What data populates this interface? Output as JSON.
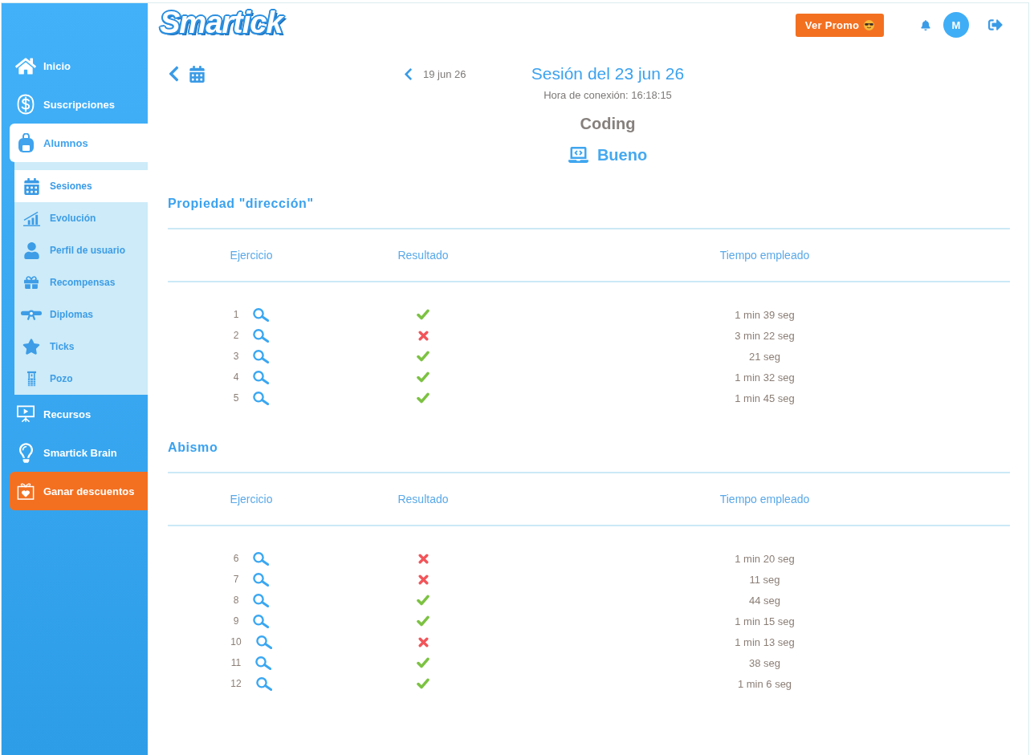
{
  "header": {
    "logo": "Smartick",
    "promo_button": "Ver Promo",
    "avatar_initial": "M"
  },
  "sidebar": {
    "items": [
      {
        "label": "Inicio",
        "kind": "nav",
        "selected": false
      },
      {
        "label": "Suscripciones",
        "kind": "nav",
        "selected": false
      },
      {
        "label": "Alumnos",
        "kind": "nav",
        "selected": true,
        "children": [
          {
            "label": "Sesiones",
            "selected": true
          },
          {
            "label": "Evolución",
            "selected": false
          },
          {
            "label": "Perfil de usuario",
            "selected": false
          },
          {
            "label": "Recompensas",
            "selected": false
          },
          {
            "label": "Diplomas",
            "selected": false
          },
          {
            "label": "Ticks",
            "selected": false
          },
          {
            "label": "Pozo",
            "selected": false
          }
        ]
      },
      {
        "label": "Recursos",
        "kind": "nav",
        "selected": false
      },
      {
        "label": "Smartick Brain",
        "kind": "nav",
        "selected": false
      },
      {
        "label": "Ganar descuentos",
        "kind": "promo",
        "selected": false
      }
    ]
  },
  "session": {
    "previous_session": "19 jun 26",
    "title": "Sesión del 23 jun 26",
    "connection_time": "Hora de conexión: 16:18:15",
    "subject": "Coding",
    "rating": "Bueno"
  },
  "sections": [
    {
      "title": "Propiedad \"dirección\"",
      "columns": [
        "Ejercicio",
        "Resultado",
        "Tiempo empleado"
      ],
      "rows": [
        {
          "number": "1",
          "correct": true,
          "time": "1 min 39 seg"
        },
        {
          "number": "2",
          "correct": false,
          "time": "3 min 22 seg"
        },
        {
          "number": "3",
          "correct": true,
          "time": "21 seg"
        },
        {
          "number": "4",
          "correct": true,
          "time": "1 min 32 seg"
        },
        {
          "number": "5",
          "correct": true,
          "time": "1 min 45 seg"
        }
      ]
    },
    {
      "title": "Abismo",
      "columns": [
        "Ejercicio",
        "Resultado",
        "Tiempo empleado"
      ],
      "rows": [
        {
          "number": "6",
          "correct": false,
          "time": "1 min 20 seg"
        },
        {
          "number": "7",
          "correct": false,
          "time": "11 seg"
        },
        {
          "number": "8",
          "correct": true,
          "time": "44 seg"
        },
        {
          "number": "9",
          "correct": true,
          "time": "1 min 15 seg"
        },
        {
          "number": "10",
          "correct": false,
          "time": "1 min 13 seg"
        },
        {
          "number": "11",
          "correct": true,
          "time": "38 seg"
        },
        {
          "number": "12",
          "correct": true,
          "time": "1 min 6 seg"
        }
      ]
    }
  ]
}
